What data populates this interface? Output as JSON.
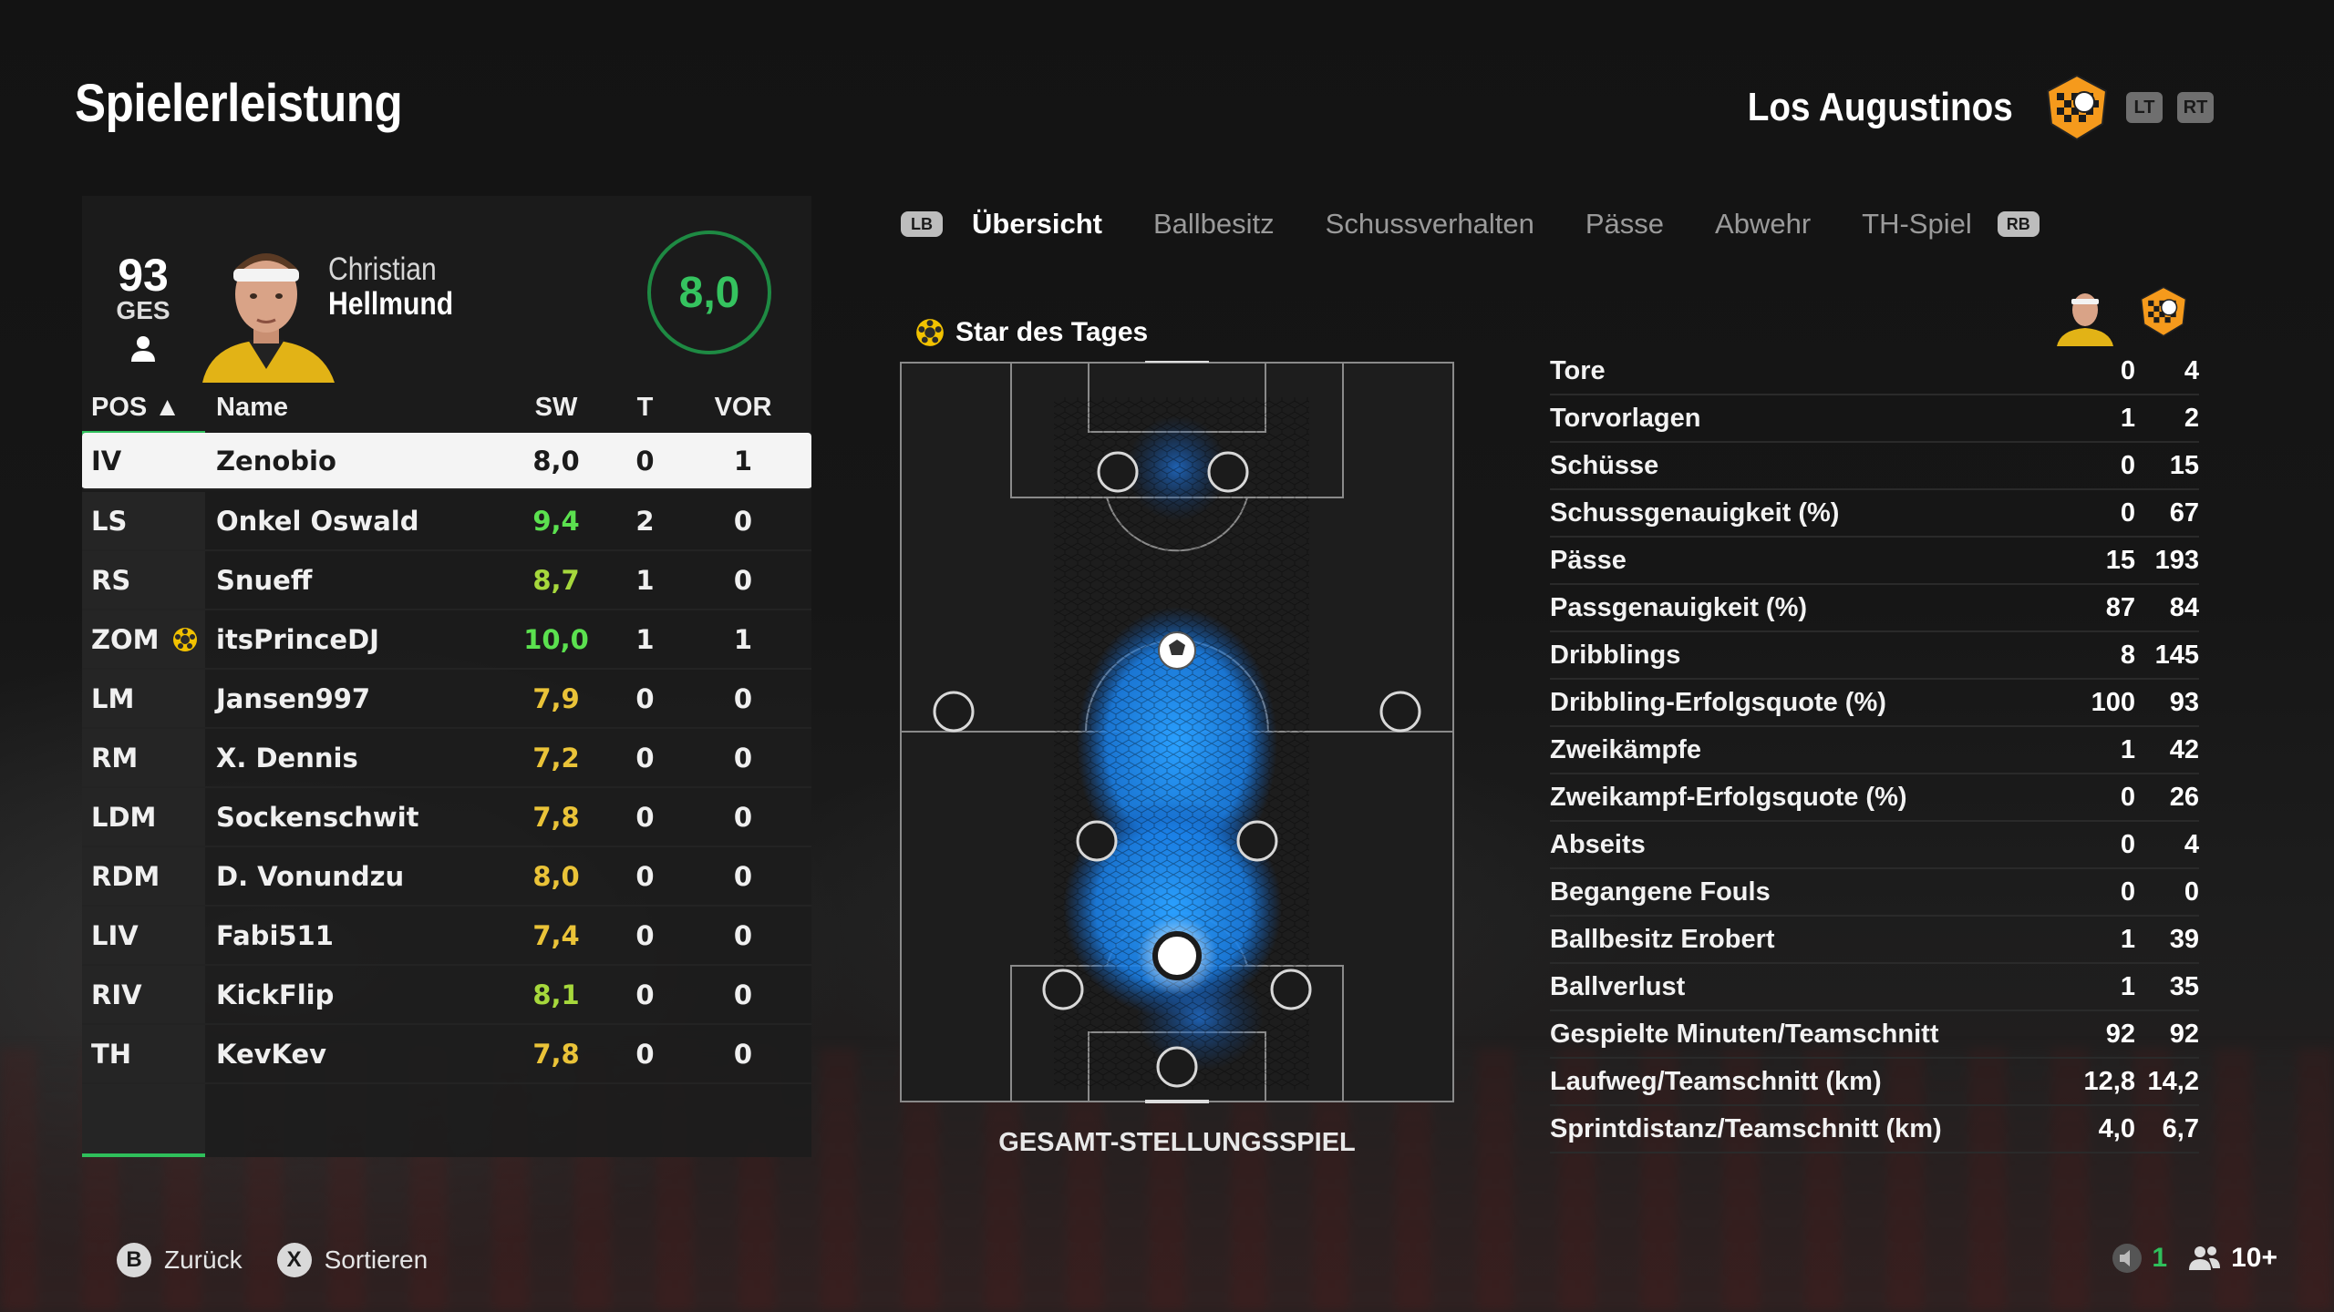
{
  "page_title": "Spielerleistung",
  "team": {
    "name": "Los Augustinos",
    "lt": "LT",
    "rt": "RT"
  },
  "player": {
    "overall": "93",
    "overall_label": "GES",
    "first_name": "Christian",
    "last_name": "Hellmund",
    "rating": "8,0"
  },
  "table": {
    "headers": {
      "pos": "POS ▲",
      "name": "Name",
      "sw": "SW",
      "t": "T",
      "vor": "VOR"
    },
    "rows": [
      {
        "pos": "IV",
        "name": "Zenobio",
        "sw": "8,0",
        "t": "0",
        "vor": "1",
        "selected": true
      },
      {
        "pos": "LS",
        "name": "Onkel Oswald",
        "sw": "9,4",
        "t": "2",
        "vor": "0"
      },
      {
        "pos": "RS",
        "name": "Snueff",
        "sw": "8,7",
        "t": "1",
        "vor": "0"
      },
      {
        "pos": "ZOM",
        "name": "itsPrinceDJ",
        "sw": "10,0",
        "t": "1",
        "vor": "1",
        "star": true
      },
      {
        "pos": "LM",
        "name": "Jansen997",
        "sw": "7,9",
        "t": "0",
        "vor": "0"
      },
      {
        "pos": "RM",
        "name": "X. Dennis",
        "sw": "7,2",
        "t": "0",
        "vor": "0"
      },
      {
        "pos": "LDM",
        "name": "Sockenschwit",
        "sw": "7,8",
        "t": "0",
        "vor": "0"
      },
      {
        "pos": "RDM",
        "name": "D. Vonundzu",
        "sw": "8,0",
        "t": "0",
        "vor": "0"
      },
      {
        "pos": "LIV",
        "name": "Fabi511",
        "sw": "7,4",
        "t": "0",
        "vor": "0"
      },
      {
        "pos": "RIV",
        "name": "KickFlip",
        "sw": "8,1",
        "t": "0",
        "vor": "0"
      },
      {
        "pos": "TH",
        "name": "KevKev",
        "sw": "7,8",
        "t": "0",
        "vor": "0"
      }
    ]
  },
  "tabs": {
    "lb": "LB",
    "rb": "RB",
    "items": [
      "Übersicht",
      "Ballbesitz",
      "Schussverhalten",
      "Pässe",
      "Abwehr",
      "TH-Spiel"
    ],
    "active": 0
  },
  "star_of_day": "Star des Tages",
  "pitch_caption": "GESAMT-STELLUNGSSPIEL",
  "stats": [
    {
      "label": "Tore",
      "player": "0",
      "team": "4"
    },
    {
      "label": "Torvorlagen",
      "player": "1",
      "team": "2"
    },
    {
      "label": "Schüsse",
      "player": "0",
      "team": "15"
    },
    {
      "label": "Schussgenauigkeit (%)",
      "player": "0",
      "team": "67"
    },
    {
      "label": "Pässe",
      "player": "15",
      "team": "193"
    },
    {
      "label": "Passgenauigkeit (%)",
      "player": "87",
      "team": "84"
    },
    {
      "label": "Dribblings",
      "player": "8",
      "team": "145"
    },
    {
      "label": "Dribbling-Erfolgsquote (%)",
      "player": "100",
      "team": "93"
    },
    {
      "label": "Zweikämpfe",
      "player": "1",
      "team": "42"
    },
    {
      "label": "Zweikampf-Erfolgsquote (%)",
      "player": "0",
      "team": "26"
    },
    {
      "label": "Abseits",
      "player": "0",
      "team": "4"
    },
    {
      "label": "Begangene Fouls",
      "player": "0",
      "team": "0"
    },
    {
      "label": "Ballbesitz Erobert",
      "player": "1",
      "team": "39"
    },
    {
      "label": "Ballverlust",
      "player": "1",
      "team": "35"
    },
    {
      "label": "Gespielte Minuten/Teamschnitt",
      "player": "92",
      "team": "92"
    },
    {
      "label": "Laufweg/Teamschnitt (km)",
      "player": "12,8",
      "team": "14,2"
    },
    {
      "label": "Sprintdistanz/Teamschnitt (km)",
      "player": "4,0",
      "team": "6,7"
    }
  ],
  "footer": {
    "back_key": "B",
    "back": "Zurück",
    "sort_key": "X",
    "sort": "Sortieren",
    "count": "1",
    "players": "10+"
  },
  "colors": {
    "accent_green": "#2fbf5b",
    "heat_blue": "#1e90ff",
    "star_yellow": "#f2c200",
    "crest_orange": "#f59a1c"
  }
}
